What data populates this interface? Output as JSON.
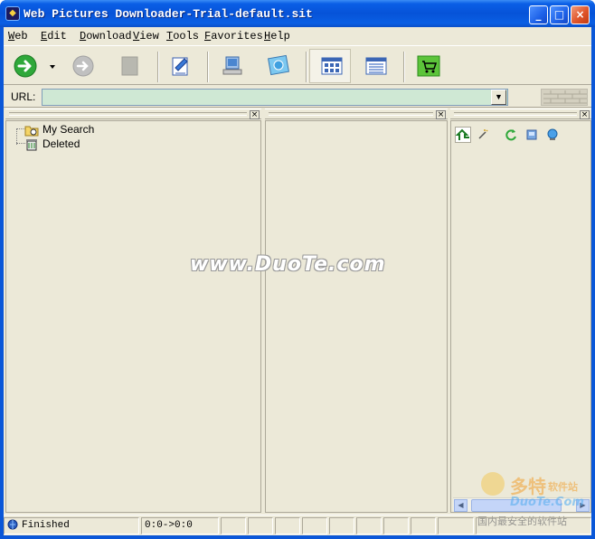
{
  "window": {
    "title": "Web Pictures Downloader-Trial-default.sit",
    "controls": {
      "minimize": "_",
      "maximize": "□",
      "close": "×"
    }
  },
  "menu": [
    {
      "label": "Web",
      "mnemonic": "W",
      "rest": "eb"
    },
    {
      "label": "Edit",
      "mnemonic": "E",
      "rest": "dit"
    },
    {
      "label": "Download",
      "mnemonic": "D",
      "rest": "ownload"
    },
    {
      "label": "View",
      "mnemonic": "V",
      "rest": "iew"
    },
    {
      "label": "Tools",
      "mnemonic": "T",
      "rest": "ools"
    },
    {
      "label": "Favorites",
      "mnemonic": "F",
      "rest": "avorites"
    },
    {
      "label": "Help",
      "mnemonic": "H",
      "rest": "elp"
    }
  ],
  "toolbar": {
    "icons": [
      "go-icon",
      "dropdown-arrow-icon",
      "forward-icon",
      "stop-icon",
      "edit-icon",
      "computer-icon",
      "browser-icon",
      "thumbnail-view-icon",
      "list-view-icon",
      "shopping-cart-icon"
    ],
    "colors": {
      "go": "#2fa83a",
      "cart": "#5cc43a"
    }
  },
  "urlbar": {
    "label": "URL:",
    "value": "",
    "field_color": "#cfe8d4"
  },
  "tree": {
    "items": [
      {
        "label": "My Search",
        "icon": "folder-search-icon"
      },
      {
        "label": "Deleted",
        "icon": "recycle-bin-icon"
      }
    ]
  },
  "watermark": {
    "text": "www.DuoTe.com"
  },
  "logo_watermark": {
    "brand": "多特",
    "brand_suffix": "软件站",
    "site": "DuoTe.Com",
    "slogan": "国内最安全的软件站"
  },
  "status": {
    "text": "Finished",
    "counter": "0:0->0:0"
  }
}
